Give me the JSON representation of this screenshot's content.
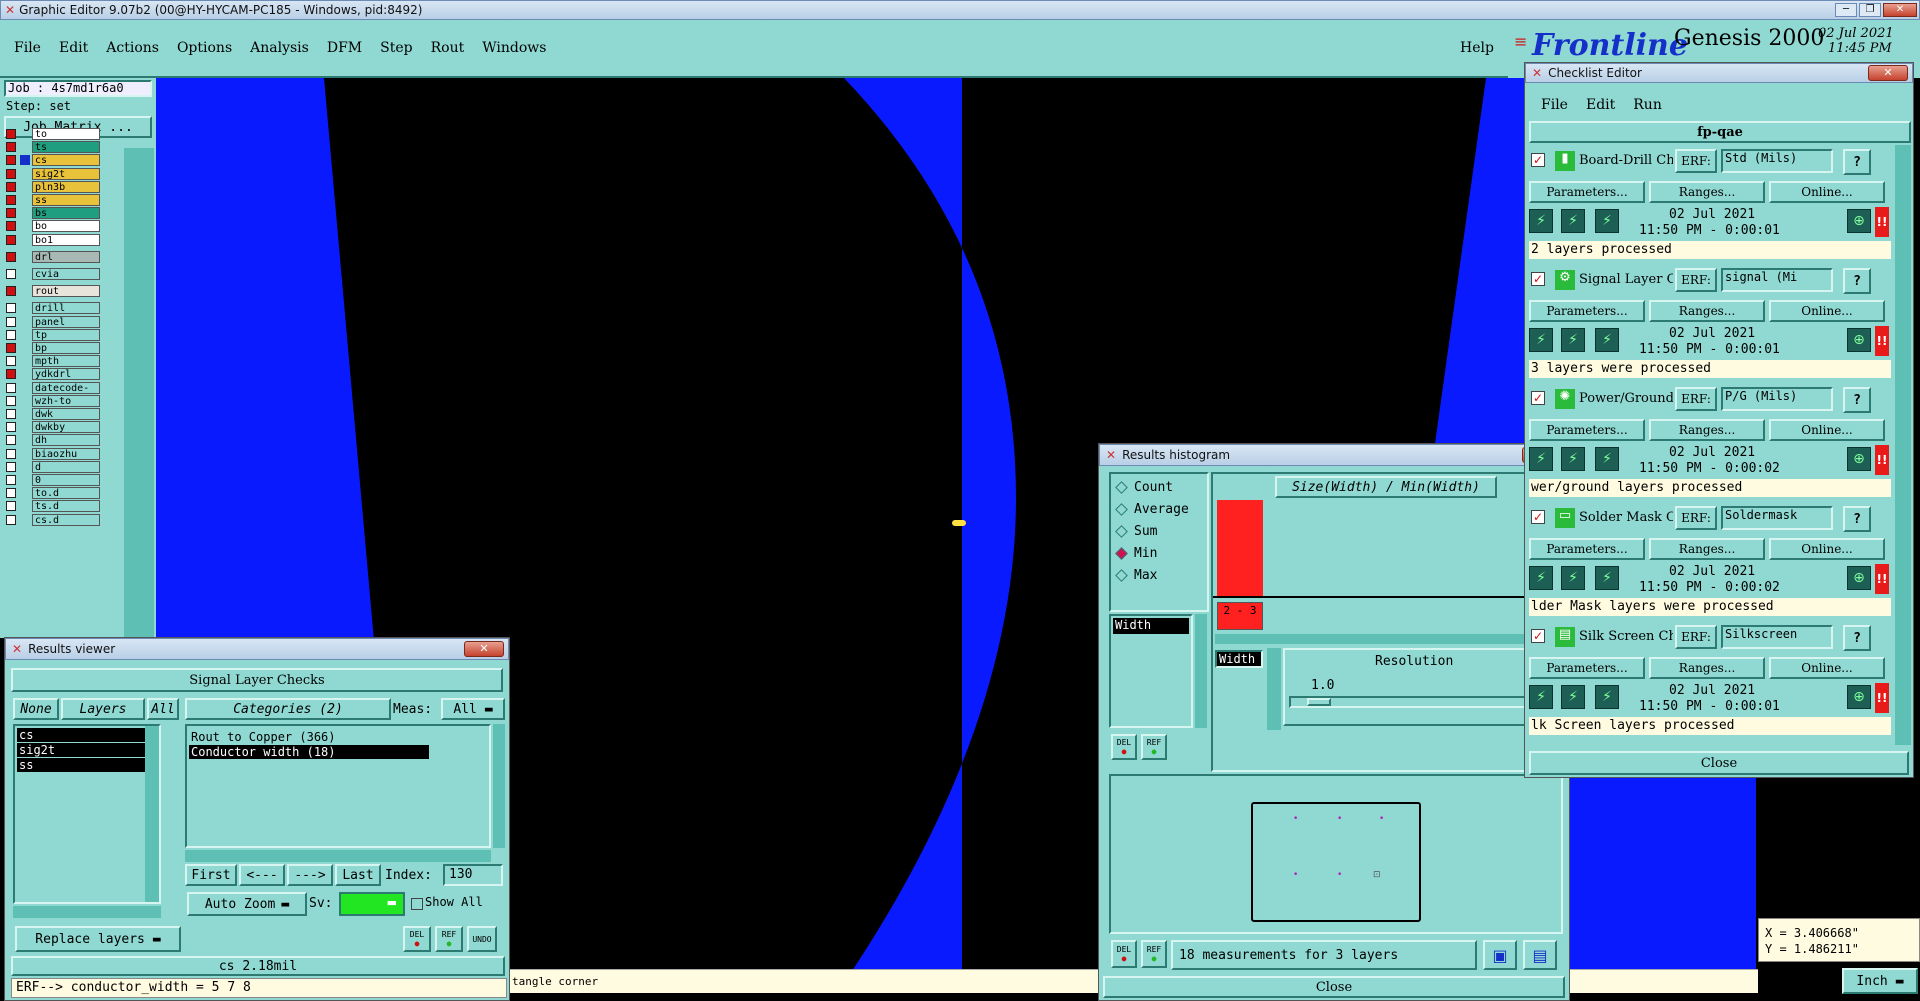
{
  "app": {
    "title": "Graphic Editor 9.07b2 (00@HY-HYCAM-PC185 - Windows, pid:8492)",
    "menu": [
      "File",
      "Edit",
      "Actions",
      "Options",
      "Analysis",
      "DFM",
      "Step",
      "Rout",
      "Windows"
    ],
    "help": "Help",
    "brand": "Frontline",
    "product": "Genesis 2000",
    "date": "02 Jul 2021",
    "time": "11:45 PM"
  },
  "job": {
    "job_label": "Job : 4s7md1r6a0",
    "step_label": "Step: set",
    "matrix_button": "Job Matrix ...",
    "layers": [
      {
        "name": "to",
        "color": "#ffffff",
        "on": true
      },
      {
        "name": "ts",
        "color": "#1f9e80",
        "on": true
      },
      {
        "name": "cs",
        "color": "#e8c23a",
        "on": true,
        "active": true
      },
      {
        "name": "sig2t",
        "color": "#e8c23a",
        "on": true
      },
      {
        "name": "pln3b",
        "color": "#e8c23a",
        "on": true
      },
      {
        "name": "ss",
        "color": "#e8c23a",
        "on": true
      },
      {
        "name": "bs",
        "color": "#1f9e80",
        "on": true
      },
      {
        "name": "bo",
        "color": "#ffffff",
        "on": true
      },
      {
        "name": "bo1",
        "color": "#ffffff",
        "on": true
      },
      {
        "name": "drl",
        "color": "#a8b8b4",
        "on": true
      },
      {
        "name": "cvia",
        "color": "#8fd9d2",
        "on": false
      },
      {
        "name": "rout",
        "color": "#e8e4dc",
        "on": true
      },
      {
        "name": "drill",
        "color": "#8fd9d2",
        "on": false
      },
      {
        "name": "panel",
        "color": "#8fd9d2",
        "on": false
      },
      {
        "name": "tp",
        "color": "#8fd9d2",
        "on": false
      },
      {
        "name": "bp",
        "color": "#8fd9d2",
        "on": true
      },
      {
        "name": "mpth",
        "color": "#8fd9d2",
        "on": false
      },
      {
        "name": "ydkdrl",
        "color": "#8fd9d2",
        "on": true
      },
      {
        "name": "datecode-pt",
        "color": "#8fd9d2",
        "on": false
      },
      {
        "name": "wzh-to",
        "color": "#8fd9d2",
        "on": false
      },
      {
        "name": "dwk",
        "color": "#8fd9d2",
        "on": false
      },
      {
        "name": "dwkby",
        "color": "#8fd9d2",
        "on": false
      },
      {
        "name": "dh",
        "color": "#8fd9d2",
        "on": false
      },
      {
        "name": "biaozhu",
        "color": "#8fd9d2",
        "on": false
      },
      {
        "name": "d",
        "color": "#8fd9d2",
        "on": false
      },
      {
        "name": "0",
        "color": "#8fd9d2",
        "on": false
      },
      {
        "name": "to.d",
        "color": "#8fd9d2",
        "on": false
      },
      {
        "name": "ts.d",
        "color": "#8fd9d2",
        "on": false
      },
      {
        "name": "cs.d",
        "color": "#8fd9d2",
        "on": false
      }
    ]
  },
  "results_viewer": {
    "title": "Results viewer",
    "header": "Signal Layer Checks",
    "none_btn": "None",
    "layers_btn": "Layers",
    "all_btn": "All",
    "categories_label": "Categories (2)",
    "meas_label": "Meas:",
    "meas_value": "All",
    "layers": [
      "cs",
      "sig2t",
      "ss"
    ],
    "categories": [
      "Rout to Copper (366)",
      "Conductor width (18)"
    ],
    "first": "First",
    "prev": "<---",
    "next": "--->",
    "last": "Last",
    "index_label": "Index:",
    "index_value": "130",
    "auto_zoom": "Auto Zoom",
    "sv_label": "Sv:",
    "show_all": "Show All",
    "replace_layers": "Replace layers",
    "del": "DEL",
    "ref": "REF",
    "undo": "UNDO",
    "status": "cs 2.18mil",
    "erf_line": "ERF--> conductor_width = 5 7 8"
  },
  "status_bar": {
    "message": "tangle corner",
    "x": "X = 3.406668\"",
    "y": "Y = 1.486211\"",
    "units": "Inch"
  },
  "histogram": {
    "title": "Results histogram",
    "options": [
      "Count",
      "Average",
      "Sum",
      "Min",
      "Max"
    ],
    "selected": "Min",
    "chart_title": "Size(Width) / Min(Width)",
    "measure": "Width",
    "resolution_label": "Resolution",
    "resolution_value": "1.0",
    "summary": "18 measurements for 3 layers",
    "close": "Close",
    "del": "DEL",
    "ref": "REF"
  },
  "chart_data": {
    "type": "bar",
    "title": "Size(Width) / Min(Width)",
    "categories": [
      "2 - 3"
    ],
    "values": [
      2.18
    ],
    "data_labels": [
      "2.18"
    ],
    "colors": [
      "#ff2020"
    ]
  },
  "checklist": {
    "title": "Checklist Editor",
    "menu": [
      "File",
      "Edit",
      "Run"
    ],
    "name": "fp-qae",
    "close": "Close",
    "params": "Parameters...",
    "ranges": "Ranges...",
    "online": "Online...",
    "erf": "ERF:",
    "items": [
      {
        "name": "Board-Drill Che",
        "erf": "Std (Mils)",
        "date": "02 Jul 2021",
        "time": "11:50 PM - 0:00:01",
        "msg": "2 layers processed"
      },
      {
        "name": "Signal Layer Ch",
        "erf": "signal (Mi",
        "date": "02 Jul 2021",
        "time": "11:50 PM - 0:00:01",
        "msg": "3 layers were processed"
      },
      {
        "name": "Power/Ground C",
        "erf": "P/G (Mils)",
        "date": "02 Jul 2021",
        "time": "11:50 PM - 0:00:02",
        "msg": "wer/ground layers processed"
      },
      {
        "name": "Solder Mask Ch",
        "erf": "Soldermask",
        "date": "02 Jul 2021",
        "time": "11:50 PM - 0:00:02",
        "msg": "lder Mask layers were processed"
      },
      {
        "name": "Silk Screen Che",
        "erf": "Silkscreen",
        "date": "02 Jul 2021",
        "time": "11:50 PM - 0:00:01",
        "msg": "lk Screen layers processed"
      }
    ]
  }
}
